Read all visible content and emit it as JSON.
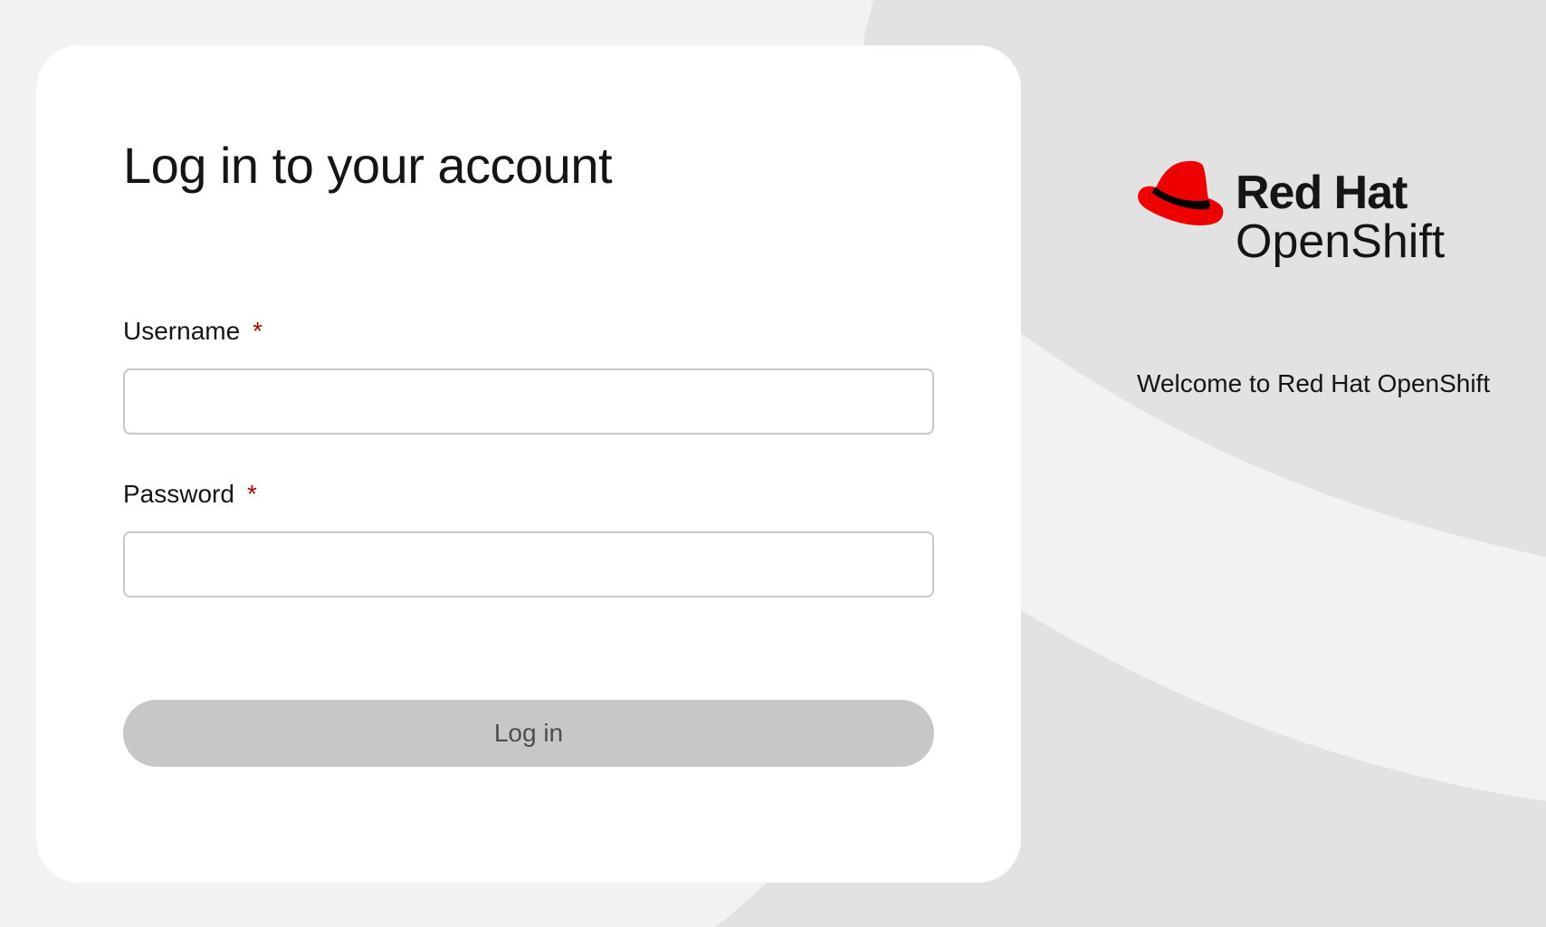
{
  "login": {
    "title": "Log in to your account",
    "username_label": "Username",
    "password_label": "Password",
    "required_marker": "*",
    "username_value": "",
    "password_value": "",
    "submit_label": "Log in"
  },
  "brand": {
    "line1": "Red Hat",
    "line2": "OpenShift",
    "welcome": "Welcome to Red Hat OpenShift",
    "logo_icon": "red-hat-fedora-icon"
  },
  "colors": {
    "page_bg": "#f2f2f2",
    "bg_arc": "#e2e2e2",
    "card_bg": "#ffffff",
    "text": "#151515",
    "required": "#a30000",
    "button_disabled_bg": "#c7c7c7",
    "button_disabled_text": "#4d4d4d",
    "hat_red": "#ee0000",
    "input_border": "#c7c7c7"
  }
}
